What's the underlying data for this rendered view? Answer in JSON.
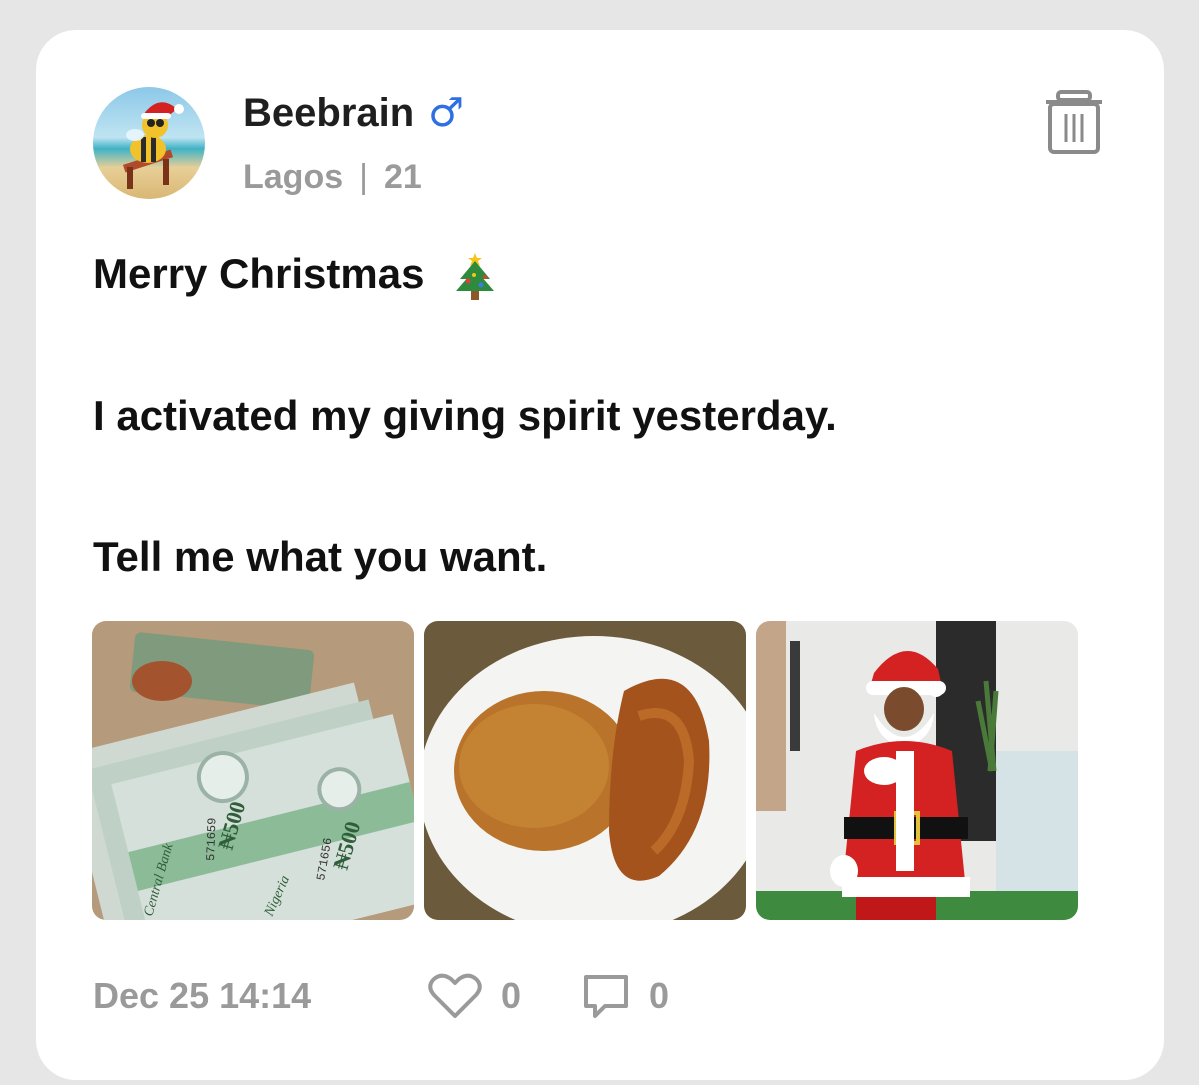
{
  "post": {
    "author": {
      "name": "Beebrain",
      "gender_symbol": "♂",
      "location": "Lagos",
      "separator": "|",
      "age": "21"
    },
    "lines": [
      "Merry Christmas",
      "I activated my giving spirit yesterday.",
      "Tell me what you want."
    ],
    "photos": [
      {
        "subject": "naira-notes"
      },
      {
        "subject": "jollof-rice-with-chicken"
      },
      {
        "subject": "santa-claus"
      }
    ],
    "photo_texts": {
      "note_value": "₦500",
      "note_serial_1": "571659",
      "note_serial_2": "571656",
      "note_bank": "Central Bank",
      "note_country": "Nigeria"
    },
    "timestamp": "Dec 25 14:14",
    "like_count": "0",
    "comment_count": "0"
  },
  "icons": {
    "delete": "trash-icon",
    "like": "heart-icon",
    "comment": "comment-icon",
    "emoji": "christmas-tree-icon"
  },
  "colors": {
    "accent_gender": "#2f6fe4",
    "muted_text": "#9a9a9a",
    "primary_text": "#111111"
  }
}
